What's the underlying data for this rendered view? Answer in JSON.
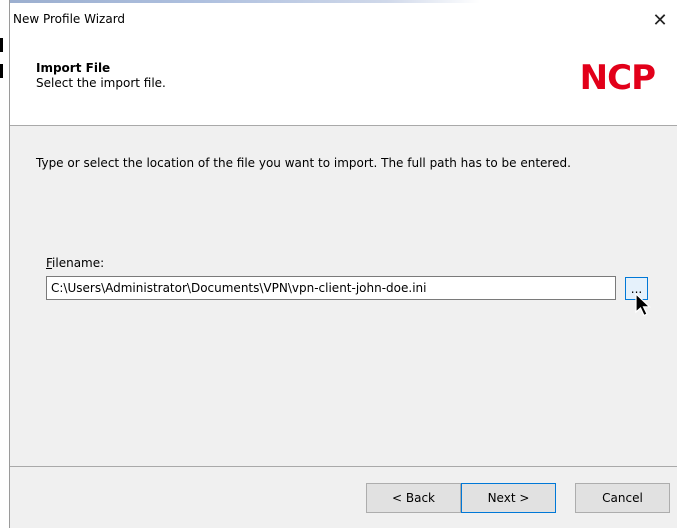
{
  "window": {
    "title": "New Profile Wizard"
  },
  "header": {
    "title": "Import File",
    "subtitle": "Select the import file.",
    "logo_text": "NCP",
    "logo_color": "#e2001a"
  },
  "main": {
    "instructions": "Type or select the location of the file you want to import. The full path has to be entered.",
    "filename_label_accel": "F",
    "filename_label_rest": "ilename:",
    "filename_value": "C:\\Users\\Administrator\\Documents\\VPN\\vpn-client-john-doe.ini",
    "browse_label": "..."
  },
  "footer": {
    "back_label": "< Back",
    "next_label": "Next >",
    "cancel_label": "Cancel"
  },
  "icons": {
    "close": "close-icon",
    "cursor": "mouse-pointer-icon"
  }
}
